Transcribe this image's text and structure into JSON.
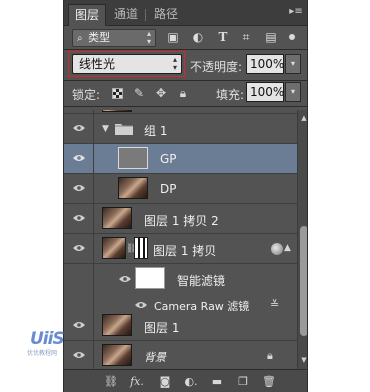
{
  "tabs": [
    {
      "label": "图层",
      "active": true
    },
    {
      "label": "通道",
      "active": false
    },
    {
      "label": "路径",
      "active": false
    }
  ],
  "filter": {
    "kind_label": "类型",
    "icons": [
      "image-filter-icon",
      "adjustment-filter-icon",
      "type-filter-icon",
      "shape-filter-icon",
      "smart-object-filter-icon",
      "filter-toggle-icon"
    ]
  },
  "blend": {
    "mode": "线性光"
  },
  "opacity": {
    "label": "不透明度:",
    "value": "100%"
  },
  "lock": {
    "label": "锁定:"
  },
  "fill": {
    "label": "填充:",
    "value": "100%"
  },
  "layers": [
    {
      "name": "组 1",
      "type": "group"
    },
    {
      "name": "GP",
      "type": "layer",
      "selected": true
    },
    {
      "name": "DP",
      "type": "layer"
    },
    {
      "name": "图层 1 拷贝 2",
      "type": "layer"
    },
    {
      "name": "图层 1 拷贝",
      "type": "smart"
    },
    {
      "name": "智能滤镜",
      "type": "smart-filter"
    },
    {
      "name": "Camera Raw 滤镜",
      "type": "filter"
    },
    {
      "name": "图层 1",
      "type": "layer"
    },
    {
      "name": "背景",
      "type": "background"
    }
  ],
  "watermark": {
    "logo": "UiiS",
    "sub": "优优教程网"
  },
  "colors": {
    "panel": "#535353",
    "selected_row": "#6b7d94",
    "highlight_outline": "#d02a2a"
  }
}
